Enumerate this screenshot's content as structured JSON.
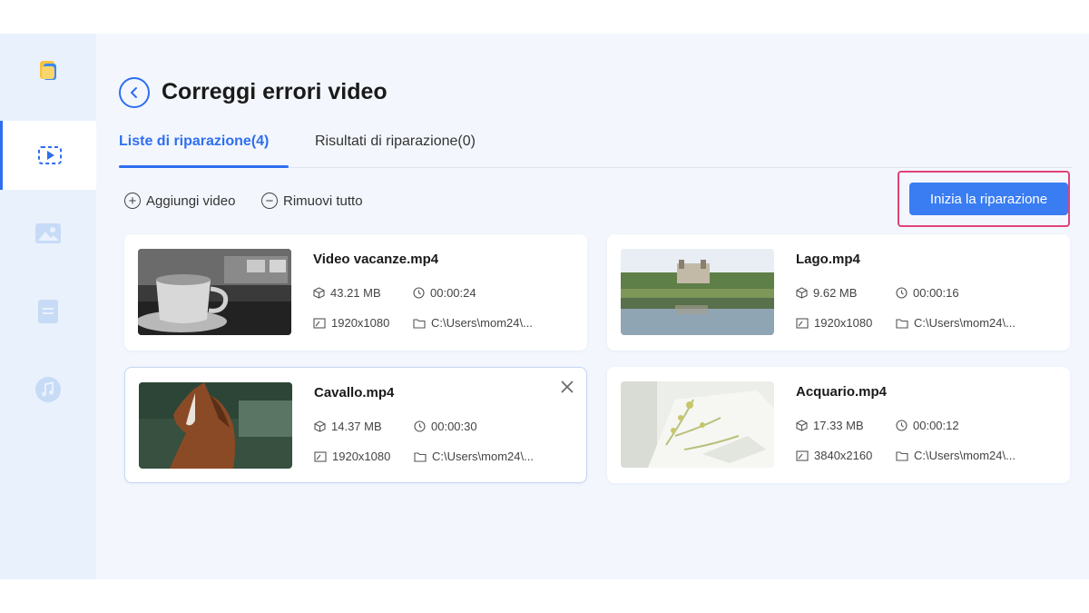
{
  "page": {
    "title": "Correggi errori video"
  },
  "tabs": [
    {
      "label": "Liste di riparazione(4)",
      "active": true
    },
    {
      "label": "Risultati di riparazione(0)",
      "active": false
    }
  ],
  "toolbar": {
    "add_label": "Aggiungi video",
    "remove_all_label": "Rimuovi tutto",
    "start_label": "Inizia la riparazione"
  },
  "sidebar": {
    "items": [
      {
        "icon": "folder-icon",
        "active": false
      },
      {
        "icon": "video-icon",
        "active": true
      },
      {
        "icon": "image-icon",
        "active": false
      },
      {
        "icon": "document-icon",
        "active": false
      },
      {
        "icon": "music-icon",
        "active": false
      }
    ]
  },
  "files": [
    {
      "name": "Video vacanze.mp4",
      "size": "43.21 MB",
      "duration": "00:00:24",
      "resolution": "1920x1080",
      "path": "C:\\Users\\mom24\\..."
    },
    {
      "name": "Lago.mp4",
      "size": "9.62 MB",
      "duration": "00:00:16",
      "resolution": "1920x1080",
      "path": "C:\\Users\\mom24\\..."
    },
    {
      "name": "Cavallo.mp4",
      "size": "14.37 MB",
      "duration": "00:00:30",
      "resolution": "1920x1080",
      "path": "C:\\Users\\mom24\\..."
    },
    {
      "name": "Acquario.mp4",
      "size": "17.33 MB",
      "duration": "00:00:12",
      "resolution": "3840x2160",
      "path": "C:\\Users\\mom24\\..."
    }
  ],
  "colors": {
    "accent": "#2f6ef0",
    "button": "#3a7df3",
    "highlight": "#e0427a",
    "background": "#f3f7fd",
    "sidebar": "#e9f1fc"
  }
}
